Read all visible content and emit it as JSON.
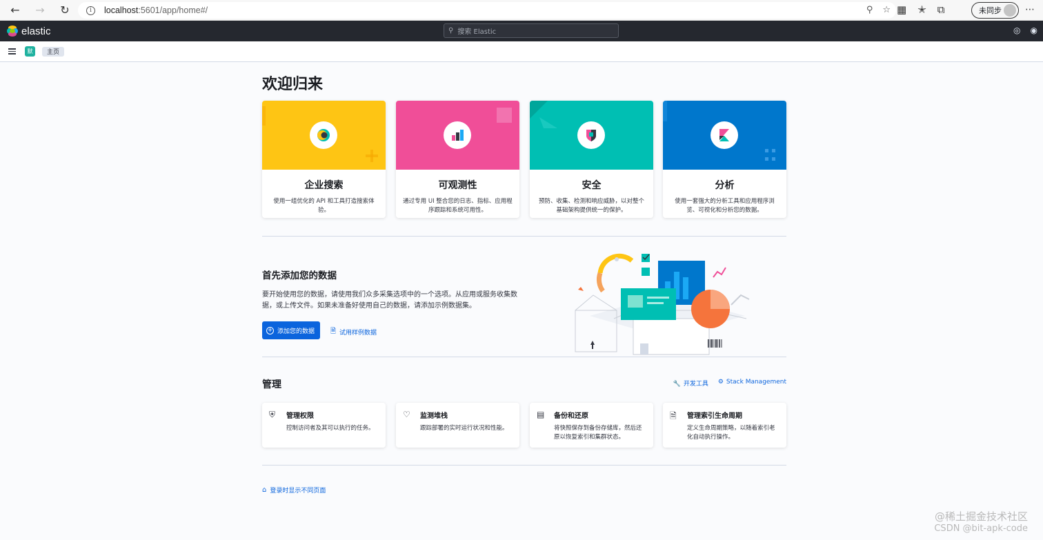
{
  "browser": {
    "url_host": "localhost",
    "url_rest": ":5601/app/home#/",
    "sync_label": "未同步",
    "icons": [
      "back-icon",
      "forward-icon",
      "refresh-icon",
      "info-icon",
      "zoom-icon",
      "favorite-icon",
      "extensions-icon",
      "favorites-icon",
      "collections-icon",
      "more-icon"
    ]
  },
  "header": {
    "logo_text": "elastic",
    "search_placeholder": "搜索 Elastic"
  },
  "breadcrumb": {
    "space_initial": "默",
    "current": "主页"
  },
  "home": {
    "welcome": "欢迎归来",
    "solutions": [
      {
        "title": "企业搜索",
        "desc": "使用一组优化的 API 和工具打造搜索体验。",
        "color": "#fec514"
      },
      {
        "title": "可观测性",
        "desc": "通过专用 UI 整合您的日志、指标、应用程序跟踪和系统可用性。",
        "color": "#f04e98"
      },
      {
        "title": "安全",
        "desc": "预防、收集、检测和响应威胁，以对整个基础架构提供统一的保护。",
        "color": "#00bfb3"
      },
      {
        "title": "分析",
        "desc": "使用一套强大的分析工具和应用程序浏览、可视化和分析您的数据。",
        "color": "#0077cc"
      }
    ],
    "add_data": {
      "title": "首先添加您的数据",
      "text": "要开始使用您的数据，请使用我们众多采集选项中的一个选项。从应用或服务收集数据，或上传文件。如果未准备好使用自己的数据，请添加示例数据集。",
      "button": "添加您的数据",
      "sample_link": "试用样例数据"
    },
    "management": {
      "title": "管理",
      "dev_tools": "开发工具",
      "stack_management": "Stack Management",
      "cards": [
        {
          "title": "管理权限",
          "desc": "控制访问者及其可以执行的任务。",
          "icon": "shield-icon"
        },
        {
          "title": "监测堆栈",
          "desc": "跟踪部署的实时运行状况和性能。",
          "icon": "heartbeat-icon"
        },
        {
          "title": "备份和还原",
          "desc": "将快照保存到备份存储库，然后还原以恢复索引和集群状态。",
          "icon": "storage-icon"
        },
        {
          "title": "管理索引生命周期",
          "desc": "定义生命周期策略，以随着索引老化自动执行操作。",
          "icon": "document-icon"
        }
      ]
    },
    "footer_link": "登录时显示不同页面"
  },
  "watermark": {
    "line1": "@稀土掘金技术社区",
    "line2": "CSDN @bit-apk-code"
  }
}
